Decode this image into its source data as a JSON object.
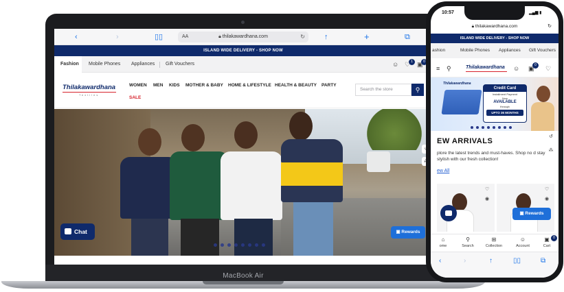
{
  "laptop": {
    "brand": "MacBook Air",
    "browser": {
      "url": "thilakawardhana.com",
      "text_size": "AA"
    },
    "promo": "ISLAND WIDE DELIVERY - SHOP NOW",
    "categories": [
      "Fashion",
      "Mobile Phones",
      "Appliances",
      "Gift Vouchers"
    ],
    "wishlist_count": "1",
    "cart_count": "0",
    "logo": "Thilakawardhana",
    "logo_sub": "Textiles",
    "menu": [
      "WOMEN",
      "MEN",
      "KIDS",
      "MOTHER & BABY",
      "HOME & LIFESTYLE",
      "HEALTH & BEAUTY",
      "PARTY",
      "SALE"
    ],
    "search_placeholder": "Search the store",
    "chat_label": "Chat",
    "rewards_label": "Rewards"
  },
  "phone": {
    "time": "10:57",
    "url": "thilakawardhana.com",
    "promo": "ISLAND WIDE DELIVERY - SHOP NOW",
    "categories": [
      "ashion",
      "Mobile Phones",
      "Appliances",
      "Gift Vouchers"
    ],
    "logo": "Thilakawardhana",
    "cart_count": "0",
    "banner": {
      "logo": "Thilakawardhana",
      "title": "Credit Card",
      "subtitle": "Installment Payment",
      "now": "Now",
      "available": "AVAILABLE",
      "through": "through",
      "upto": "UPTO 36 MONTHS"
    },
    "section_title": "EW ARRIVALS",
    "section_desc": "plore the latest trends and must-haves. Shop no d stay stylish with our fresh collection!",
    "view_all": "ew All",
    "rewards_label": "Rewards",
    "tabs": [
      "ome",
      "Search",
      "Collection",
      "Account",
      "Cart"
    ],
    "tab_cart_count": "0"
  },
  "colors": {
    "brand_navy": "#0f2a6b",
    "sale_red": "#d6202a",
    "rewards_blue": "#1e6fd9"
  },
  "icons": [
    "chevron-left-icon",
    "chevron-right-icon",
    "book-icon",
    "lock-icon",
    "reload-icon",
    "share-icon",
    "plus-icon",
    "tabs-icon",
    "user-icon",
    "heart-icon",
    "bag-icon",
    "search-icon",
    "chat-icon",
    "gift-icon",
    "history-icon",
    "share-node-icon",
    "menu-icon",
    "eye-icon",
    "home-icon",
    "grid-icon",
    "signal-icon"
  ]
}
